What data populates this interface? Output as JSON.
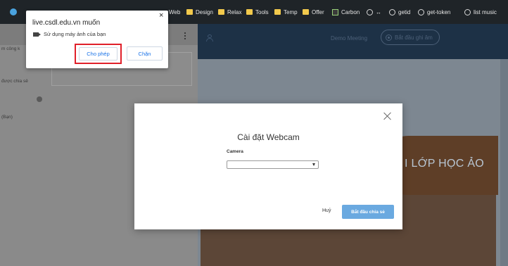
{
  "bookmarks": [
    {
      "label": "Web",
      "icon": "folder-icon"
    },
    {
      "label": "Design",
      "icon": "folder-icon"
    },
    {
      "label": "Relax",
      "icon": "folder-icon"
    },
    {
      "label": "Tools",
      "icon": "folder-icon"
    },
    {
      "label": "Temp",
      "icon": "folder-icon"
    },
    {
      "label": "Offer",
      "icon": "folder-icon"
    },
    {
      "label": "Carbon",
      "icon": "carbon-icon"
    },
    {
      "label": "↔",
      "icon": "globe-icon"
    },
    {
      "label": "getid",
      "icon": "globe-icon"
    },
    {
      "label": "get-token",
      "icon": "globe-icon"
    },
    {
      "label": "list music",
      "icon": "globe-icon"
    }
  ],
  "left_panel": {
    "item1": "m công k",
    "item2": "được chia sẻ",
    "item3": "(Bạn)"
  },
  "main": {
    "meeting_title": "Demo Meeting",
    "record_label": "Bắt đầu ghi âm",
    "banner_text": "I LỚP HỌC ẢO"
  },
  "permission_popup": {
    "title": "live.csdl.edu.vn muốn",
    "close_symbol": "×",
    "request": "Sử dụng máy ảnh của bạn",
    "allow_label": "Cho phép",
    "block_label": "Chặn"
  },
  "webcam_modal": {
    "title": "Cài đặt Webcam",
    "camera_label": "Camera",
    "camera_selected": "",
    "cancel_label": "Huỷ",
    "start_label": "Bắt đầu chia sẻ"
  }
}
